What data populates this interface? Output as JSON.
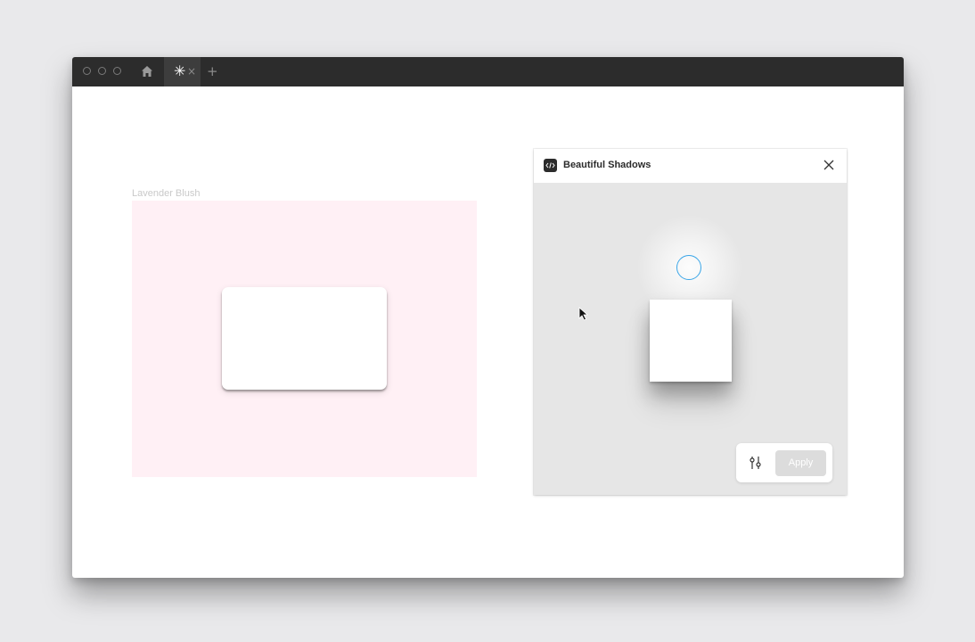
{
  "titlebar": {
    "tab_glyph": "✳",
    "tab_close": "×",
    "new_tab": "+"
  },
  "canvas": {
    "frame_label": "Lavender Blush",
    "frame_color": "#fff0f5"
  },
  "plugin": {
    "title": "Beautiful Shadows",
    "apply_label": "Apply",
    "accent": "#3aa6e8",
    "icons": [
      "code-icon",
      "close-icon",
      "sliders-icon",
      "light-source-handle",
      "pointer-cursor-icon"
    ]
  }
}
